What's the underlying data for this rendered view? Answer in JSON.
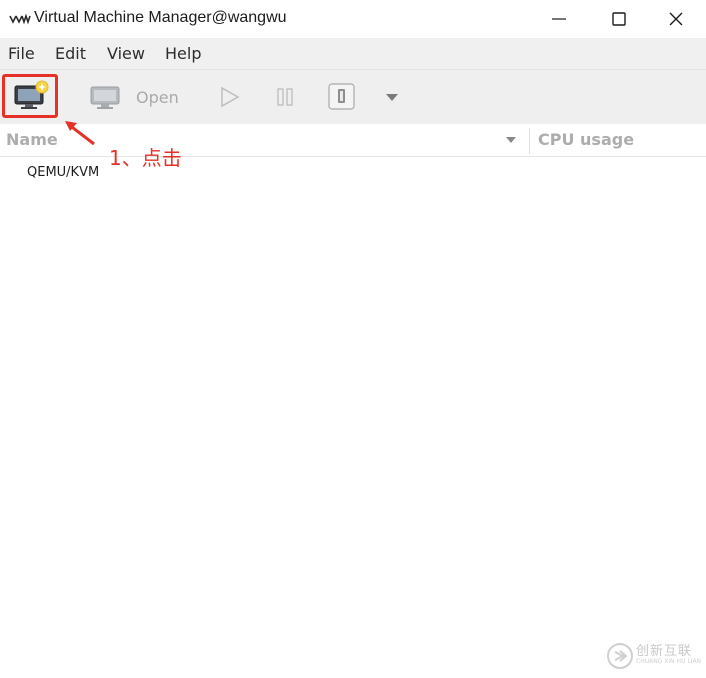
{
  "window": {
    "title": "Virtual Machine Manager@wangwu",
    "icon": "vmm-app-icon"
  },
  "menubar": {
    "items": [
      "File",
      "Edit",
      "View",
      "Help"
    ]
  },
  "toolbar": {
    "new_vm_icon": "new-vm-monitor-icon",
    "open_label": "Open",
    "run_icon": "play-icon",
    "pause_icon": "pause-icon",
    "shutdown_icon": "stop-icon",
    "menu_icon": "chevron-down-icon"
  },
  "list": {
    "columns": [
      "Name",
      "CPU usage"
    ],
    "rows": [
      "QEMU/KVM"
    ]
  },
  "annotation": {
    "text": "1、点击",
    "color": "#e53228"
  },
  "watermark": {
    "text": "创新互联",
    "sub": "CHUANG XIN HU LIAN"
  }
}
